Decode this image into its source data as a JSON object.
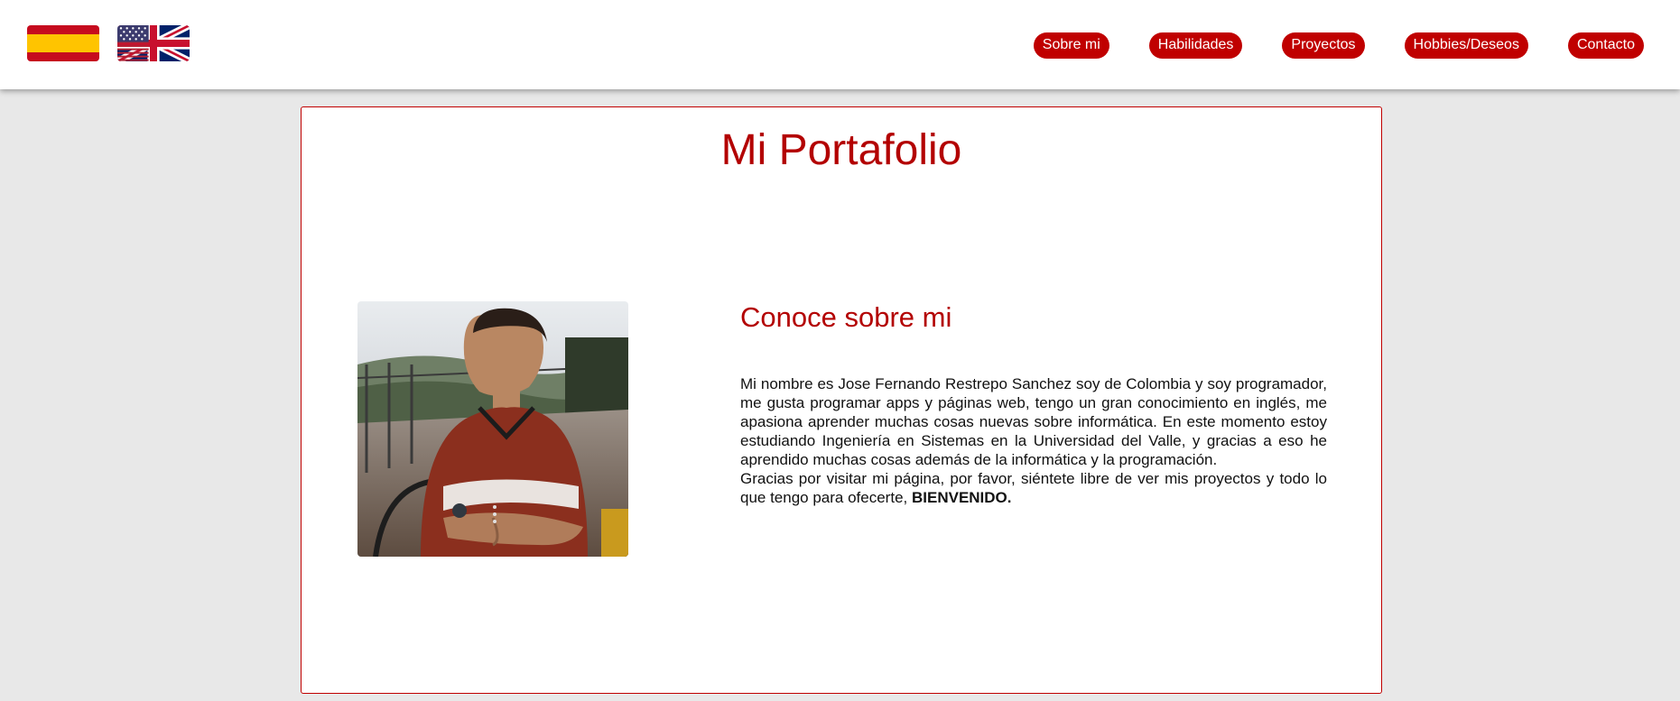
{
  "header": {
    "flags": [
      {
        "name": "spain-flag",
        "colors": [
          "#c60b1e",
          "#ffc400"
        ]
      },
      {
        "name": "uk-flag",
        "colors": [
          "#012169",
          "#ffffff",
          "#c8102e"
        ]
      }
    ],
    "nav": [
      {
        "label": "Sobre mi"
      },
      {
        "label": "Habilidades"
      },
      {
        "label": "Proyectos"
      },
      {
        "label": "Hobbies/Deseos"
      },
      {
        "label": "Contacto"
      }
    ]
  },
  "main": {
    "title": "Mi Portafolio",
    "about": {
      "heading": "Conoce sobre mi",
      "paragraph1": "Mi nombre es Jose Fernando Restrepo Sanchez soy de Colombia y soy programador, me gusta programar apps y páginas web, tengo un gran conocimiento en inglés, me apasiona aprender muchas cosas nuevas sobre informática. En este momento estoy estudiando Ingeniería en Sistemas en la Universidad del Valle, y gracias a eso he aprendido muchas cosas además de la informática y la programación.",
      "paragraph2": "Gracias por visitar mi página, por favor, siéntete libre de ver mis proyectos y todo lo que tengo para ofecerte,",
      "emphasis": "BIENVENIDO."
    }
  },
  "colors": {
    "accent": "#c00000",
    "title": "#b30000",
    "background": "#e8e8e8",
    "card": "#ffffff"
  }
}
